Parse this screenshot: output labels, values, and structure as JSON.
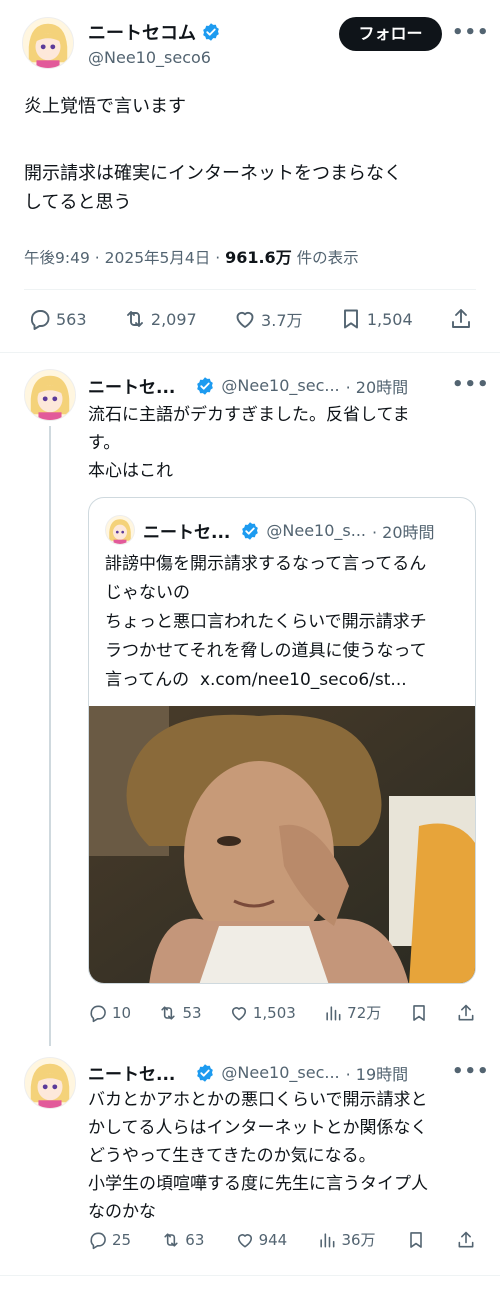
{
  "main_tweet": {
    "display_name": "ニートセコム",
    "handle": "@Nee10_seco6",
    "follow_label": "フォロー",
    "text_line1": "炎上覚悟で言います",
    "text_body": "開示請求は確実にインターネットをつまらなく\nしてると思う",
    "time": "午後9:49",
    "date": "2025年5月4日",
    "views_count": "961.6万",
    "views_label": "件の表示",
    "replies": "563",
    "retweets": "2,097",
    "likes": "3.7万",
    "bookmarks": "1,504"
  },
  "reply1": {
    "display_name": "ニートセ...",
    "handle": "@Nee10_sec...",
    "time": "· 20時間",
    "text": "流石に主語がデカすぎました。反省してま\nす。\n本心はこれ",
    "quote": {
      "display_name": "ニートセ...",
      "handle": "@Nee10_s...",
      "time": "· 20時間",
      "text": "誹謗中傷を開示請求するなって言ってるん\nじゃないの\nちょっと悪口言われたくらいで開示請求チ\nラつかせてそれを脅しの道具に使うなって\n言ってんの  x.com/nee10_seco6/st..."
    },
    "replies": "10",
    "retweets": "53",
    "likes": "1,503",
    "views": "72万"
  },
  "reply2": {
    "display_name": "ニートセ...",
    "handle": "@Nee10_sec...",
    "time": "· 19時間",
    "text": "バカとかアホとかの悪口くらいで開示請求と\nかしてる人らはインターネットとか関係なく\nどうやって生きてきたのか気になる。\n小学生の頃喧嘩する度に先生に言うタイプ人\nなのかな",
    "replies": "25",
    "retweets": "63",
    "likes": "944",
    "views": "36万"
  },
  "colors": {
    "verified": "#1d9bf0",
    "text": "#0f1419",
    "secondary": "#536471"
  }
}
